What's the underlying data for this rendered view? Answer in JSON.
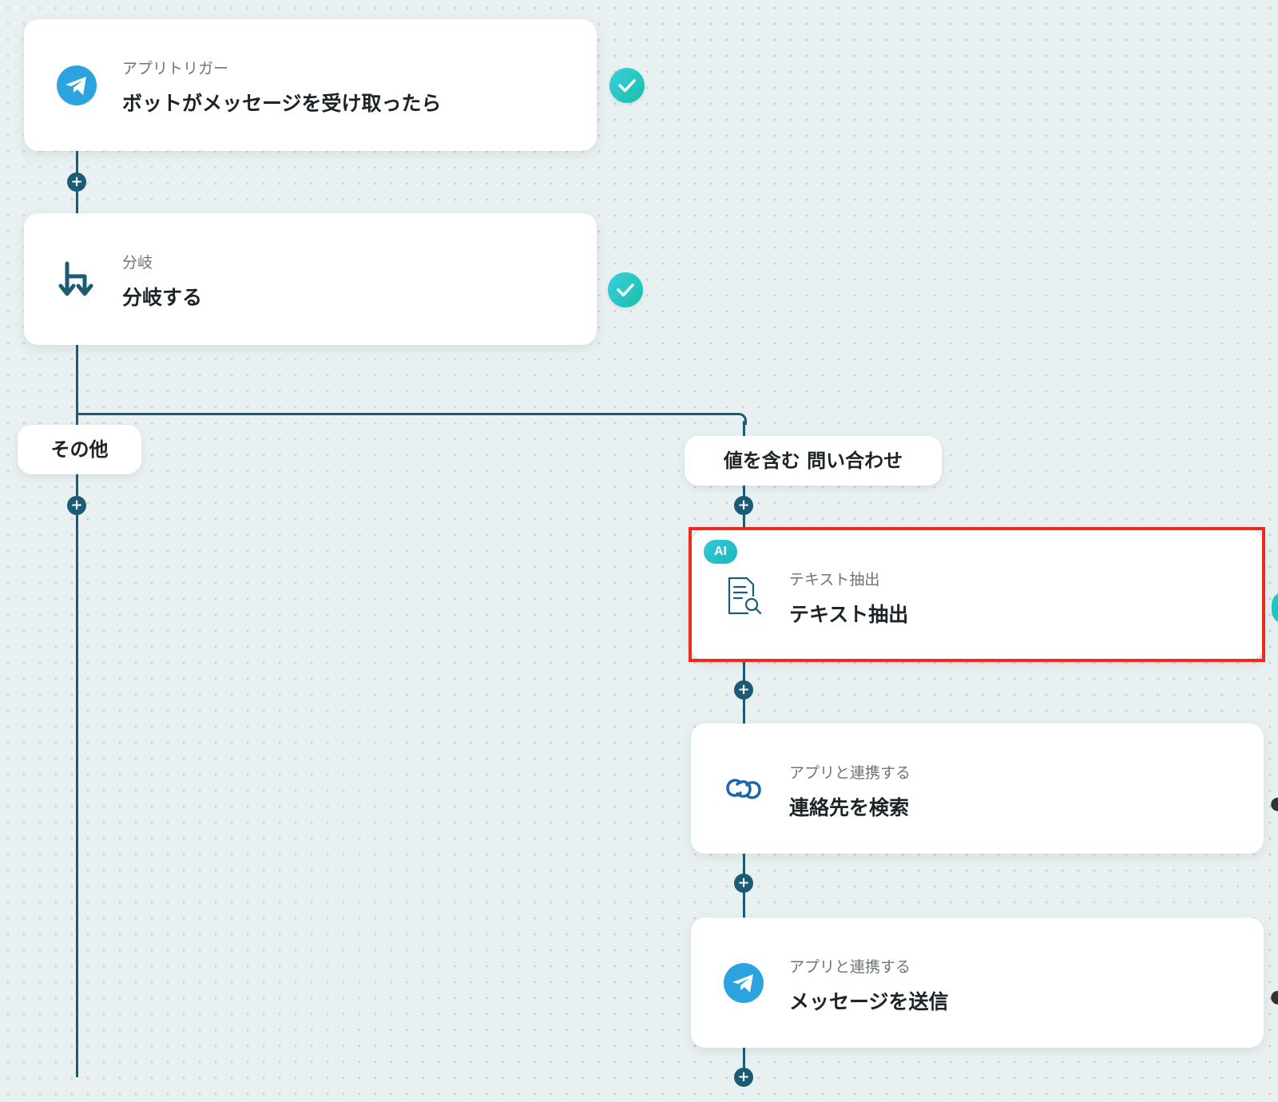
{
  "steps": {
    "trigger": {
      "subtitle": "アプリトリガー",
      "title": "ボットがメッセージを受け取ったら",
      "icon": "telegram-icon",
      "status": "complete"
    },
    "branch": {
      "subtitle": "分岐",
      "title": "分岐する",
      "icon": "branch-icon",
      "status": "complete"
    },
    "extract": {
      "badge": "AI",
      "subtitle": "テキスト抽出",
      "title": "テキスト抽出",
      "icon": "document-search-icon",
      "selected": true
    },
    "search": {
      "subtitle": "アプリと連携する",
      "title": "連絡先を検索",
      "icon": "zoho-crm-icon"
    },
    "send": {
      "subtitle": "アプリと連携する",
      "title": "メッセージを送信",
      "icon": "telegram-icon"
    }
  },
  "branches": {
    "left_label": "その他",
    "right_label": "値を含む 問い合わせ"
  },
  "add_step_symbol": "+",
  "colors": {
    "connector": "#1b5b74",
    "check": "#22c5c7",
    "highlight": "#ee2a1e",
    "telegram": "#2aa3df",
    "background": "#e9f0f1"
  }
}
